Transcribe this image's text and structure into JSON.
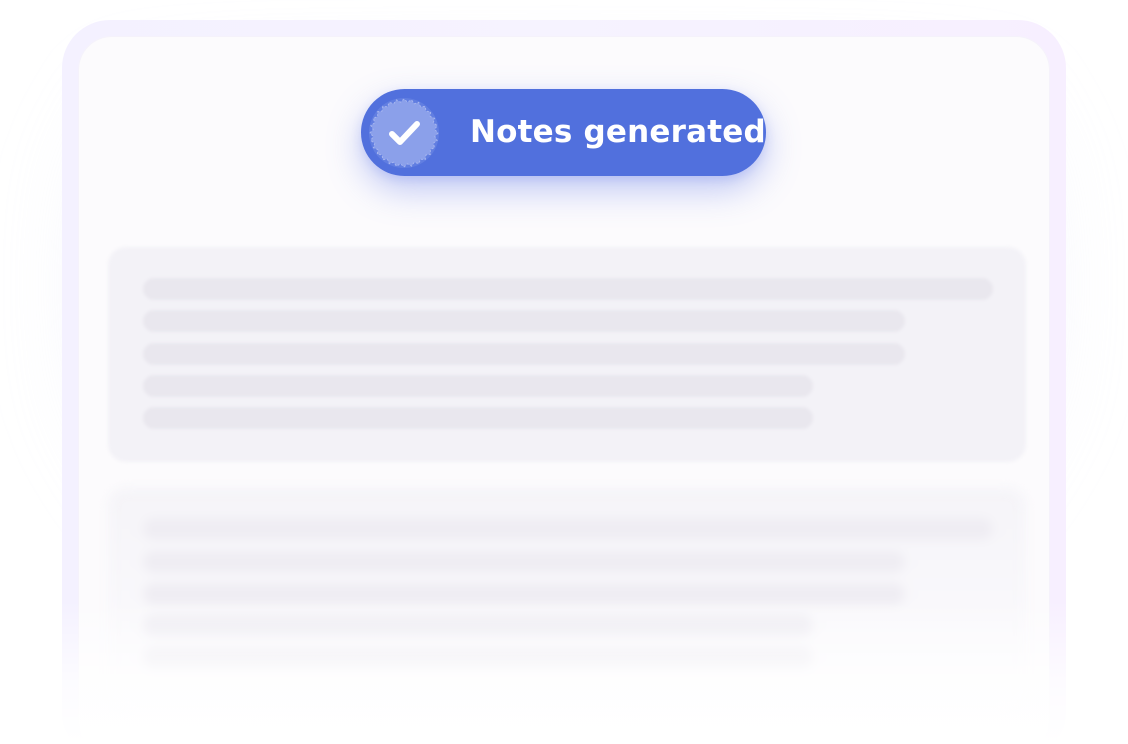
{
  "toast": {
    "label": "Notes generated",
    "icon": "check-badge-icon",
    "background_color": "#5170dd",
    "text_color": "#ffffff"
  },
  "panels": [
    {
      "state": "loading-placeholder",
      "line_count": 5
    },
    {
      "state": "loading-placeholder",
      "line_count": 5
    }
  ]
}
